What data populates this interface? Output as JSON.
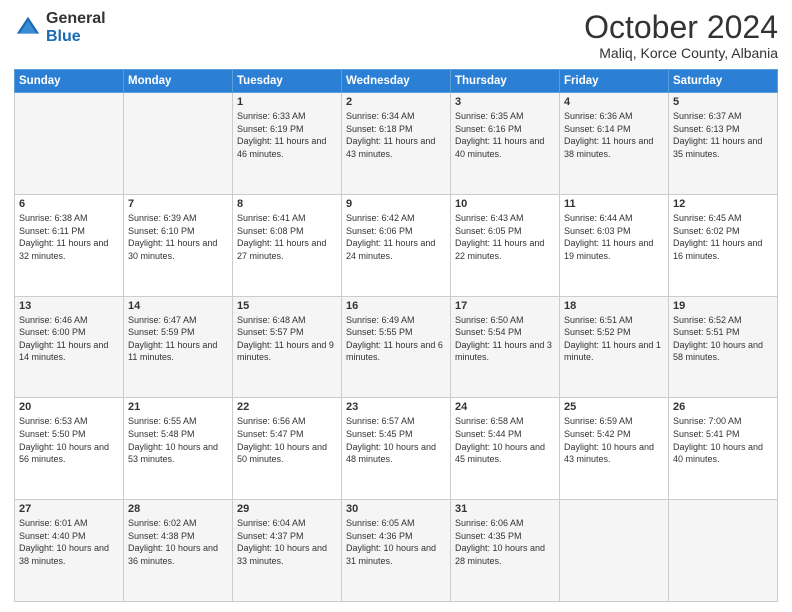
{
  "logo": {
    "general": "General",
    "blue": "Blue"
  },
  "header": {
    "month": "October 2024",
    "location": "Maliq, Korce County, Albania"
  },
  "weekdays": [
    "Sunday",
    "Monday",
    "Tuesday",
    "Wednesday",
    "Thursday",
    "Friday",
    "Saturday"
  ],
  "rows": [
    [
      {
        "num": "",
        "info": ""
      },
      {
        "num": "",
        "info": ""
      },
      {
        "num": "1",
        "info": "Sunrise: 6:33 AM\nSunset: 6:19 PM\nDaylight: 11 hours and 46 minutes."
      },
      {
        "num": "2",
        "info": "Sunrise: 6:34 AM\nSunset: 6:18 PM\nDaylight: 11 hours and 43 minutes."
      },
      {
        "num": "3",
        "info": "Sunrise: 6:35 AM\nSunset: 6:16 PM\nDaylight: 11 hours and 40 minutes."
      },
      {
        "num": "4",
        "info": "Sunrise: 6:36 AM\nSunset: 6:14 PM\nDaylight: 11 hours and 38 minutes."
      },
      {
        "num": "5",
        "info": "Sunrise: 6:37 AM\nSunset: 6:13 PM\nDaylight: 11 hours and 35 minutes."
      }
    ],
    [
      {
        "num": "6",
        "info": "Sunrise: 6:38 AM\nSunset: 6:11 PM\nDaylight: 11 hours and 32 minutes."
      },
      {
        "num": "7",
        "info": "Sunrise: 6:39 AM\nSunset: 6:10 PM\nDaylight: 11 hours and 30 minutes."
      },
      {
        "num": "8",
        "info": "Sunrise: 6:41 AM\nSunset: 6:08 PM\nDaylight: 11 hours and 27 minutes."
      },
      {
        "num": "9",
        "info": "Sunrise: 6:42 AM\nSunset: 6:06 PM\nDaylight: 11 hours and 24 minutes."
      },
      {
        "num": "10",
        "info": "Sunrise: 6:43 AM\nSunset: 6:05 PM\nDaylight: 11 hours and 22 minutes."
      },
      {
        "num": "11",
        "info": "Sunrise: 6:44 AM\nSunset: 6:03 PM\nDaylight: 11 hours and 19 minutes."
      },
      {
        "num": "12",
        "info": "Sunrise: 6:45 AM\nSunset: 6:02 PM\nDaylight: 11 hours and 16 minutes."
      }
    ],
    [
      {
        "num": "13",
        "info": "Sunrise: 6:46 AM\nSunset: 6:00 PM\nDaylight: 11 hours and 14 minutes."
      },
      {
        "num": "14",
        "info": "Sunrise: 6:47 AM\nSunset: 5:59 PM\nDaylight: 11 hours and 11 minutes."
      },
      {
        "num": "15",
        "info": "Sunrise: 6:48 AM\nSunset: 5:57 PM\nDaylight: 11 hours and 9 minutes."
      },
      {
        "num": "16",
        "info": "Sunrise: 6:49 AM\nSunset: 5:55 PM\nDaylight: 11 hours and 6 minutes."
      },
      {
        "num": "17",
        "info": "Sunrise: 6:50 AM\nSunset: 5:54 PM\nDaylight: 11 hours and 3 minutes."
      },
      {
        "num": "18",
        "info": "Sunrise: 6:51 AM\nSunset: 5:52 PM\nDaylight: 11 hours and 1 minute."
      },
      {
        "num": "19",
        "info": "Sunrise: 6:52 AM\nSunset: 5:51 PM\nDaylight: 10 hours and 58 minutes."
      }
    ],
    [
      {
        "num": "20",
        "info": "Sunrise: 6:53 AM\nSunset: 5:50 PM\nDaylight: 10 hours and 56 minutes."
      },
      {
        "num": "21",
        "info": "Sunrise: 6:55 AM\nSunset: 5:48 PM\nDaylight: 10 hours and 53 minutes."
      },
      {
        "num": "22",
        "info": "Sunrise: 6:56 AM\nSunset: 5:47 PM\nDaylight: 10 hours and 50 minutes."
      },
      {
        "num": "23",
        "info": "Sunrise: 6:57 AM\nSunset: 5:45 PM\nDaylight: 10 hours and 48 minutes."
      },
      {
        "num": "24",
        "info": "Sunrise: 6:58 AM\nSunset: 5:44 PM\nDaylight: 10 hours and 45 minutes."
      },
      {
        "num": "25",
        "info": "Sunrise: 6:59 AM\nSunset: 5:42 PM\nDaylight: 10 hours and 43 minutes."
      },
      {
        "num": "26",
        "info": "Sunrise: 7:00 AM\nSunset: 5:41 PM\nDaylight: 10 hours and 40 minutes."
      }
    ],
    [
      {
        "num": "27",
        "info": "Sunrise: 6:01 AM\nSunset: 4:40 PM\nDaylight: 10 hours and 38 minutes."
      },
      {
        "num": "28",
        "info": "Sunrise: 6:02 AM\nSunset: 4:38 PM\nDaylight: 10 hours and 36 minutes."
      },
      {
        "num": "29",
        "info": "Sunrise: 6:04 AM\nSunset: 4:37 PM\nDaylight: 10 hours and 33 minutes."
      },
      {
        "num": "30",
        "info": "Sunrise: 6:05 AM\nSunset: 4:36 PM\nDaylight: 10 hours and 31 minutes."
      },
      {
        "num": "31",
        "info": "Sunrise: 6:06 AM\nSunset: 4:35 PM\nDaylight: 10 hours and 28 minutes."
      },
      {
        "num": "",
        "info": ""
      },
      {
        "num": "",
        "info": ""
      }
    ]
  ]
}
